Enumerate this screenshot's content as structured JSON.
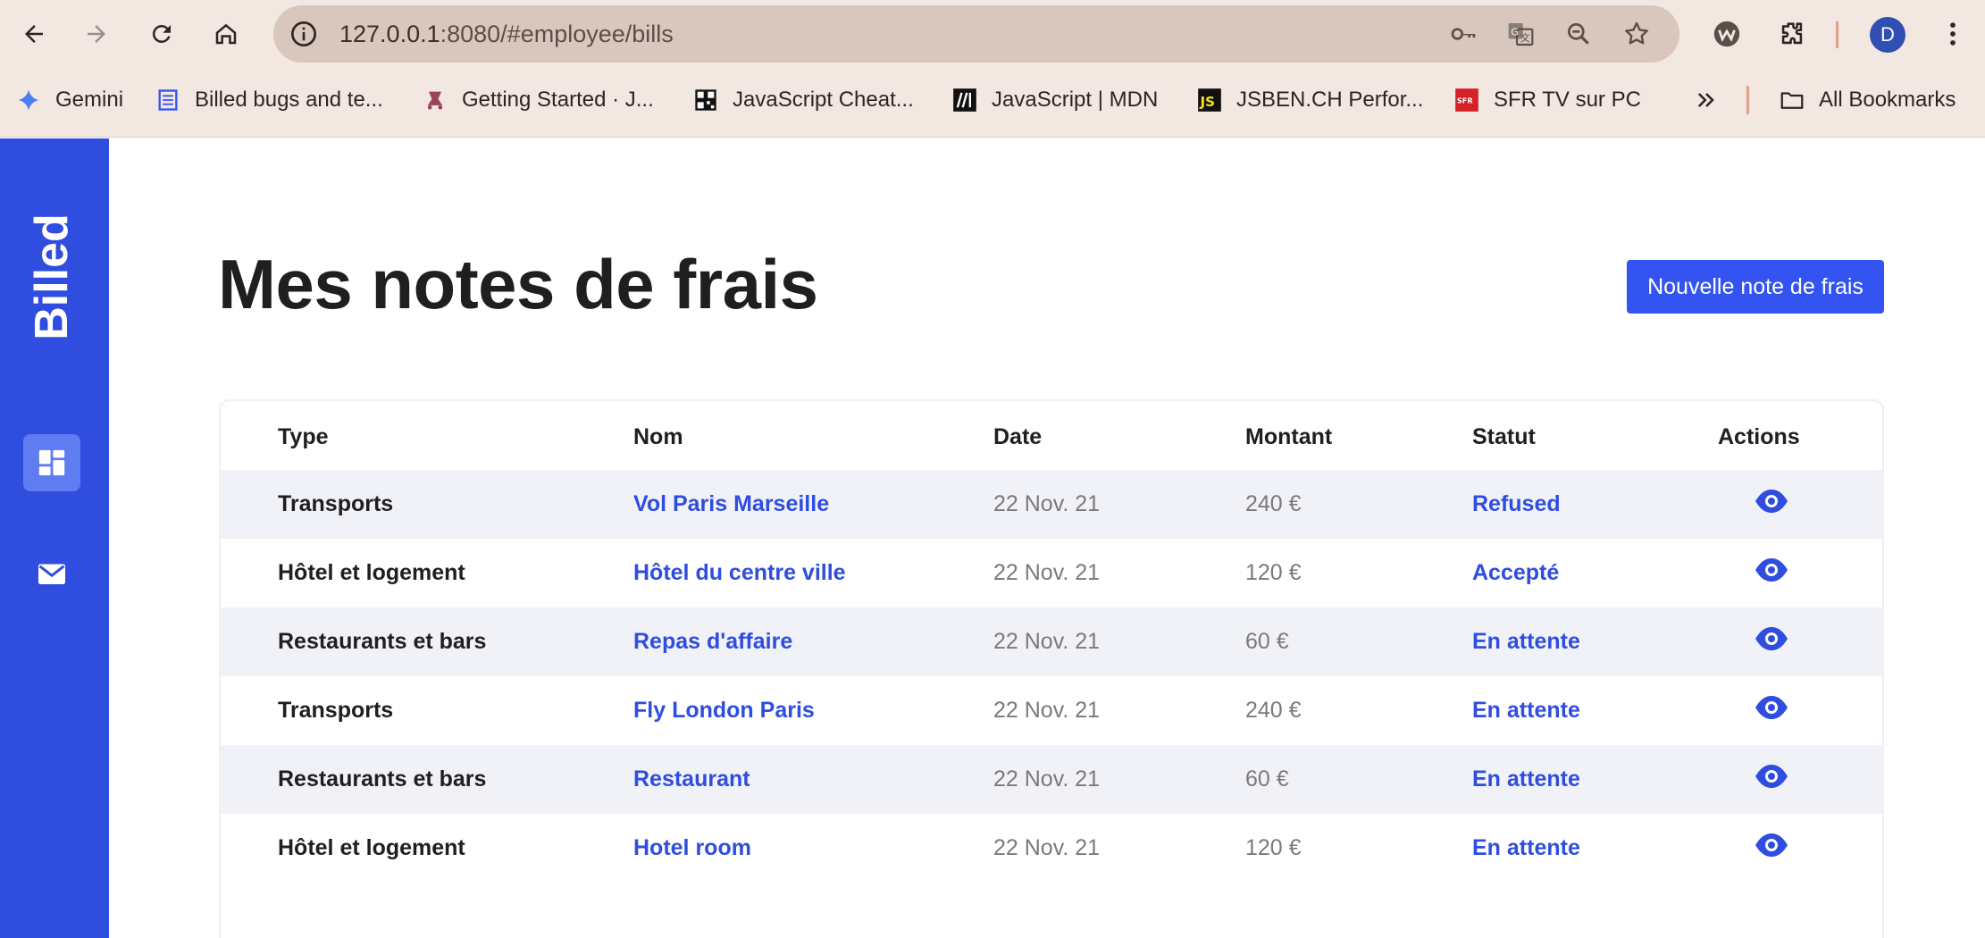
{
  "browser": {
    "url_host": "127.0.0.1",
    "url_path": ":8080/#employee/bills",
    "avatar_letter": "D",
    "bookmarks": [
      {
        "label": "Gemini",
        "icon": "gemini-sparkle-icon"
      },
      {
        "label": "Billed bugs and te...",
        "icon": "document-icon"
      },
      {
        "label": "Getting Started · J...",
        "icon": "jest-icon"
      },
      {
        "label": "JavaScript Cheat...",
        "icon": "qr-icon"
      },
      {
        "label": "JavaScript | MDN",
        "icon": "mdn-icon"
      },
      {
        "label": "JSBEN.CH Perfor...",
        "icon": "js-icon"
      },
      {
        "label": "SFR TV sur PC",
        "icon": "sfr-icon"
      }
    ],
    "all_bookmarks_label": "All Bookmarks"
  },
  "sidebar": {
    "brand": "Billed",
    "items": [
      {
        "name": "dashboard",
        "icon": "dashboard-icon",
        "active": true
      },
      {
        "name": "mail",
        "icon": "mail-icon",
        "active": false
      }
    ]
  },
  "main": {
    "title": "Mes notes de frais",
    "new_button_label": "Nouvelle note de frais"
  },
  "table": {
    "headers": [
      "Type",
      "Nom",
      "Date",
      "Montant",
      "Statut",
      "Actions"
    ],
    "rows": [
      {
        "type": "Transports",
        "nom": "Vol Paris Marseille",
        "date": "22 Nov. 21",
        "montant": "240 €",
        "statut": "Refused"
      },
      {
        "type": "Hôtel et logement",
        "nom": "Hôtel du centre ville",
        "date": "22 Nov. 21",
        "montant": "120 €",
        "statut": "Accepté"
      },
      {
        "type": "Restaurants et bars",
        "nom": "Repas d'affaire",
        "date": "22 Nov. 21",
        "montant": "60 €",
        "statut": "En attente"
      },
      {
        "type": "Transports",
        "nom": "Fly London Paris",
        "date": "22 Nov. 21",
        "montant": "240 €",
        "statut": "En attente"
      },
      {
        "type": "Restaurants et bars",
        "nom": "Restaurant",
        "date": "22 Nov. 21",
        "montant": "60 €",
        "statut": "En attente"
      },
      {
        "type": "Hôtel et logement",
        "nom": "Hotel room",
        "date": "22 Nov. 21",
        "montant": "120 €",
        "statut": "En attente"
      }
    ]
  },
  "colors": {
    "brand_blue": "#2f4ddf",
    "button_blue": "#3354f0",
    "row_alt": "#f1f2f7"
  }
}
